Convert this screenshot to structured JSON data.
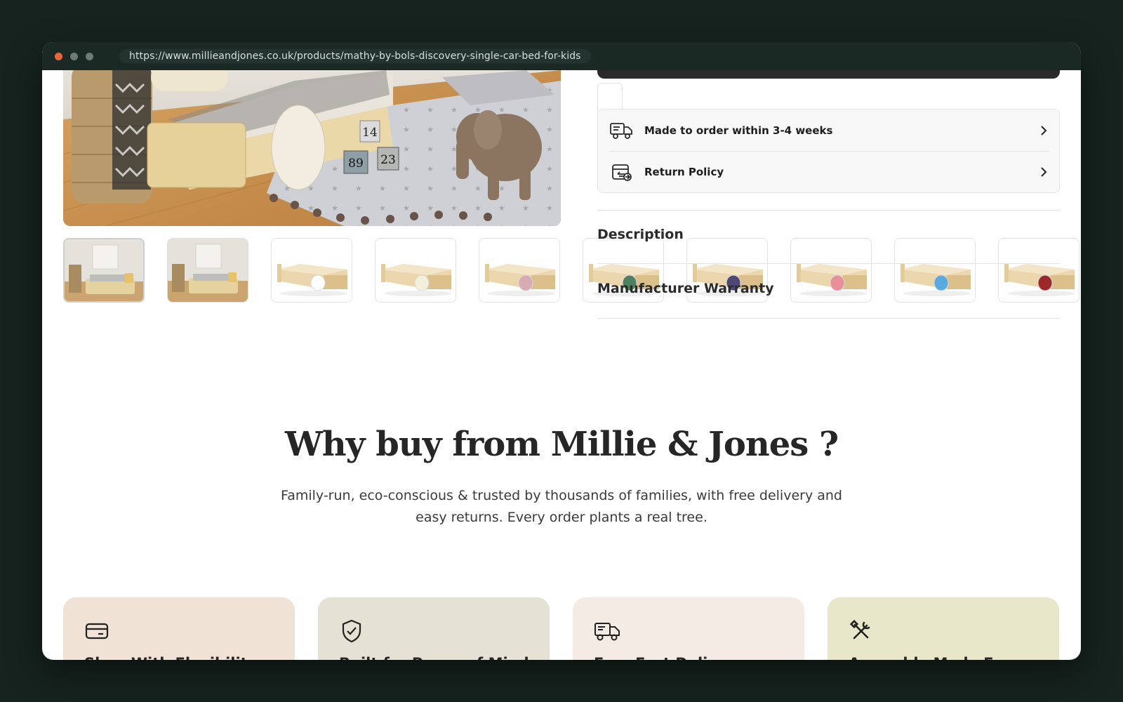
{
  "browser": {
    "url": "https://www.millieandjones.co.uk/products/mathy-by-bols-discovery-single-car-bed-for-kids"
  },
  "product": {
    "main_image_blocks": [
      "14",
      "89",
      "23"
    ],
    "thumbnails": [
      {
        "knob_color": "#e8c26a",
        "kind": "room"
      },
      {
        "knob_color": "#e8c26a",
        "kind": "room"
      },
      {
        "knob_color": "#ffffff",
        "kind": "bed"
      },
      {
        "knob_color": "#f3efd9",
        "kind": "bed"
      },
      {
        "knob_color": "#d8aab3",
        "kind": "bed"
      },
      {
        "knob_color": "#4c8060",
        "kind": "bed"
      },
      {
        "knob_color": "#4f4778",
        "kind": "bed"
      },
      {
        "knob_color": "#e88f9a",
        "kind": "bed"
      },
      {
        "knob_color": "#5aa9df",
        "kind": "bed"
      },
      {
        "knob_color": "#9c2a2a",
        "kind": "bed"
      }
    ]
  },
  "info": {
    "delivery_label": "Made to order within 3-4 weeks",
    "return_label": "Return Policy"
  },
  "accordion": {
    "description": "Description",
    "warranty": "Manufacturer Warranty"
  },
  "why": {
    "title": "Why buy from Millie & Jones ?",
    "subtitle_line1": "Family-run, eco-conscious & trusted by thousands of families, with free delivery and",
    "subtitle_line2": "easy returns. Every order plants a real tree."
  },
  "features": [
    {
      "title": "Shop With Flexibility",
      "icon": "card-icon",
      "bg": "#f1e2d6"
    },
    {
      "title": "Built for Peace of Mind",
      "icon": "shield-check-icon",
      "bg": "#e4e2d4"
    },
    {
      "title": "Free Fast Delivery",
      "icon": "truck-icon",
      "bg": "#f5ebe5"
    },
    {
      "title": "Assembly Made Easy",
      "icon": "tools-icon",
      "bg": "#e8e7c9"
    }
  ]
}
